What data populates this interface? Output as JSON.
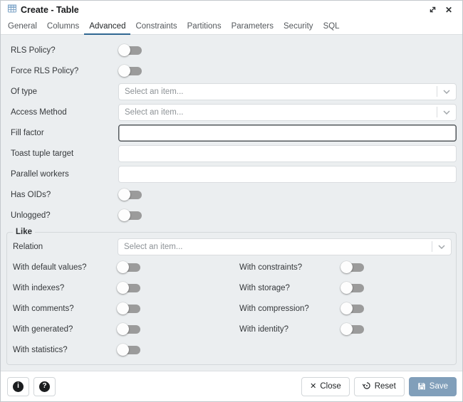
{
  "colors": {
    "accent": "#2f6792",
    "content_bg": "#ebeef0",
    "toggle_track_off": "#9b9b9b",
    "save_button_bg": "#819fba"
  },
  "window": {
    "title": "Create - Table",
    "title_icon": "table-icon",
    "expand_icon": "expand-icon",
    "close_icon": "close-icon"
  },
  "tabs": [
    {
      "label": "General",
      "active": false
    },
    {
      "label": "Columns",
      "active": false
    },
    {
      "label": "Advanced",
      "active": true
    },
    {
      "label": "Constraints",
      "active": false
    },
    {
      "label": "Partitions",
      "active": false
    },
    {
      "label": "Parameters",
      "active": false
    },
    {
      "label": "Security",
      "active": false
    },
    {
      "label": "SQL",
      "active": false
    }
  ],
  "form": {
    "select_placeholder": "Select an item...",
    "fields": {
      "rls_policy": {
        "label": "RLS Policy?",
        "type": "toggle",
        "state": "off"
      },
      "force_rls_policy": {
        "label": "Force RLS Policy?",
        "type": "toggle",
        "state": "off"
      },
      "of_type": {
        "label": "Of type",
        "type": "select",
        "value": "Select an item..."
      },
      "access_method": {
        "label": "Access Method",
        "type": "select",
        "value": "Select an item..."
      },
      "fill_factor": {
        "label": "Fill factor",
        "type": "text",
        "value": "",
        "focused": true
      },
      "toast_tuple_target": {
        "label": "Toast tuple target",
        "type": "text",
        "value": ""
      },
      "parallel_workers": {
        "label": "Parallel workers",
        "type": "text",
        "value": ""
      },
      "has_oids": {
        "label": "Has OIDs?",
        "type": "toggle",
        "state": "off"
      },
      "unlogged": {
        "label": "Unlogged?",
        "type": "toggle",
        "state": "off"
      }
    },
    "like_section": {
      "legend": "Like",
      "relation": {
        "label": "Relation",
        "type": "select",
        "value": "Select an item..."
      },
      "toggles": [
        {
          "label": "With default values?",
          "state": "off"
        },
        {
          "label": "With constraints?",
          "state": "off"
        },
        {
          "label": "With indexes?",
          "state": "off"
        },
        {
          "label": "With storage?",
          "state": "off"
        },
        {
          "label": "With comments?",
          "state": "off"
        },
        {
          "label": "With compression?",
          "state": "off"
        },
        {
          "label": "With generated?",
          "state": "off"
        },
        {
          "label": "With identity?",
          "state": "off"
        },
        {
          "label": "With statistics?",
          "state": "off"
        }
      ]
    }
  },
  "footer": {
    "info_icon": "info-icon",
    "help_icon": "help-icon",
    "close": {
      "label": "Close",
      "icon": "close-x-icon"
    },
    "reset": {
      "label": "Reset",
      "icon": "reset-icon"
    },
    "save": {
      "label": "Save",
      "icon": "save-icon"
    }
  }
}
